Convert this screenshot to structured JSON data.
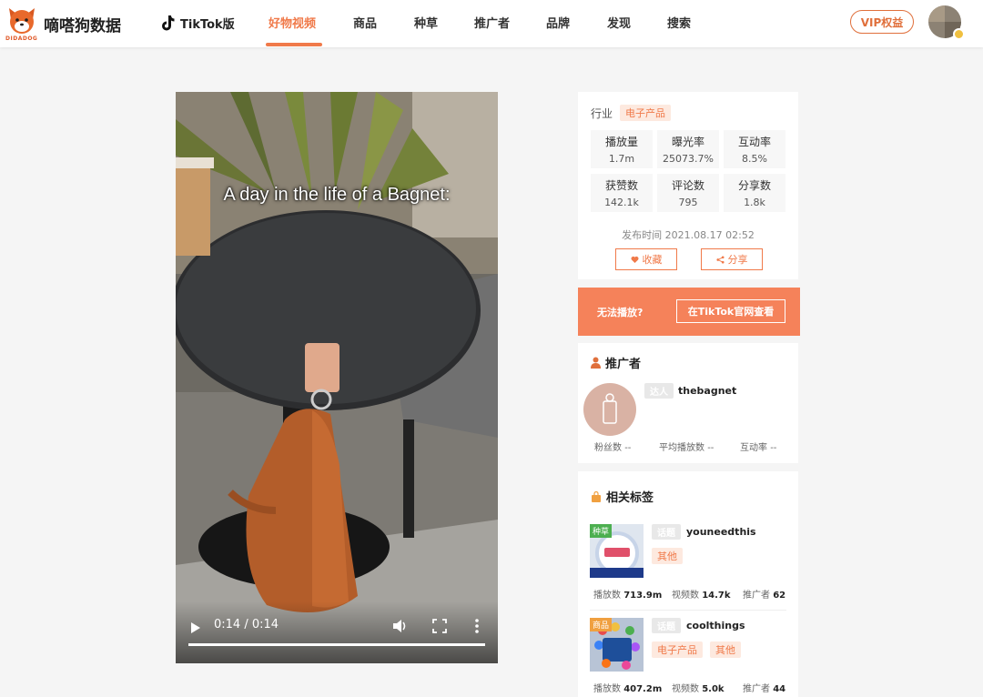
{
  "header": {
    "logo_text": "嘀嗒狗数据",
    "logo_sub": "DIDADOG",
    "tiktok_label": "TikTok版",
    "nav": [
      "好物视频",
      "商品",
      "种草",
      "推广者",
      "品牌",
      "发现",
      "搜索"
    ],
    "active_nav": "好物视频",
    "vip_label": "VIP权益",
    "brand_color": "#f07a4a"
  },
  "video": {
    "caption": "A day in the life of a Bagnet:",
    "time": "0:14 / 0:14",
    "progress": 1.0
  },
  "stats": {
    "industry_label": "行业",
    "industry_value": "电子产品",
    "items": [
      {
        "label": "播放量",
        "value": "1.7m"
      },
      {
        "label": "曝光率",
        "value": "25073.7%"
      },
      {
        "label": "互动率",
        "value": "8.5%"
      },
      {
        "label": "获赞数",
        "value": "142.1k"
      },
      {
        "label": "评论数",
        "value": "795"
      },
      {
        "label": "分享数",
        "value": "1.8k"
      }
    ],
    "publish_time": "发布时间 2021.08.17 02:52",
    "favorite_label": "收藏",
    "share_label": "分享"
  },
  "banner": {
    "text": "无法播放?",
    "button": "在TikTok官网查看"
  },
  "promoter": {
    "title": "推广者",
    "chip": "达人",
    "name": "thebagnet",
    "fans_label": "粉丝数",
    "fans_value": "--",
    "avg_play_label": "平均播放数",
    "avg_play_value": "--",
    "interaction_label": "互动率",
    "interaction_value": "--"
  },
  "tags": {
    "title": "相关标签",
    "items": [
      {
        "thumb_label": "种草",
        "thumb_label_color": "#4caf50",
        "chip": "话题",
        "name": "youneedthis",
        "categories": [
          "其他"
        ],
        "plays_label": "播放数",
        "plays": "713.9m",
        "videos_label": "视频数",
        "videos": "14.7k",
        "promoters_label": "推广者",
        "promoters": "62"
      },
      {
        "thumb_label": "商品",
        "thumb_label_color": "#f0a040",
        "chip": "话题",
        "name": "coolthings",
        "categories": [
          "电子产品",
          "其他"
        ],
        "plays_label": "播放数",
        "plays": "407.2m",
        "videos_label": "视频数",
        "videos": "5.0k",
        "promoters_label": "推广者",
        "promoters": "44"
      }
    ]
  }
}
